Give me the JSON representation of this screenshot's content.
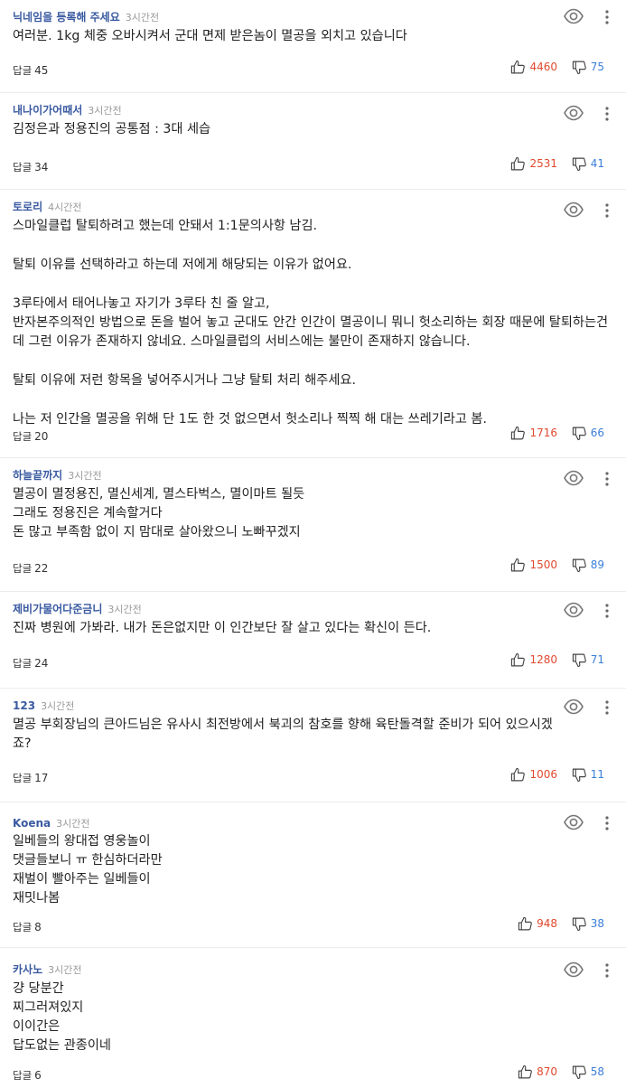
{
  "comments": [
    {
      "nickname": "닉네임을 등록해 주세요",
      "time": "3시간전",
      "body": "여러분. 1kg 체중 오바시켜서 군대 면제 받은놈이 멸공을 외치고 있습니다",
      "reply_label": "답글",
      "reply_count": "45",
      "likes": "4460",
      "dislikes": "75"
    },
    {
      "nickname": "내나이가어때서",
      "time": "3시간전",
      "body": "김정은과 정용진의 공통점 : 3대 세습",
      "reply_label": "답글",
      "reply_count": "34",
      "likes": "2531",
      "dislikes": "41"
    },
    {
      "nickname": "토로리",
      "time": "4시간전",
      "body": "스마일클럽 탈퇴하려고 했는데 안돼서 1:1문의사항 남김.\n\n탈퇴 이유를 선택하라고 하는데 저에게 해당되는 이유가 없어요.\n\n3루타에서 태어나놓고 자기가 3루타 친 줄 알고,\n반자본주의적인 방법으로 돈을 벌어 놓고 군대도 안간 인간이 멸공이니 뭐니 헛소리하는 회장 때문에 탈퇴하는건데 그런 이유가 존재하지 않네요. 스마일클럽의 서비스에는 불만이 존재하지 않습니다.\n\n탈퇴 이유에 저런 항목을 넣어주시거나 그냥 탈퇴 처리 해주세요.\n\n나는 저 인간을 멸공을 위해 단 1도 한 것 없으면서 헛소리나 찍찍 해 대는 쓰레기라고 봄.",
      "reply_label": "답글",
      "reply_count": "20",
      "likes": "1716",
      "dislikes": "66"
    },
    {
      "nickname": "하늘끝까지",
      "time": "3시간전",
      "body": "멸공이 멸정용진, 멸신세계,  멸스타벅스,  멸이마트 될듯\n그래도 정용진은 계속할거다\n돈 많고 부족함 없이 지 맘대로 살아왔으니 노빠꾸겠지",
      "reply_label": "답글",
      "reply_count": "22",
      "likes": "1500",
      "dislikes": "89"
    },
    {
      "nickname": "제비가물어다준금니",
      "time": "3시간전",
      "body": "진짜 병원에 가봐라. 내가 돈은없지만 이 인간보단 잘 살고 있다는 확신이 든다.",
      "reply_label": "답글",
      "reply_count": "24",
      "likes": "1280",
      "dislikes": "71"
    },
    {
      "nickname": "123",
      "time": "3시간전",
      "body": "멸공 부회장님의 큰아드님은 유사시 최전방에서 북괴의 참호를 향해 육탄돌격할 준비가 되어 있으시겠죠?",
      "reply_label": "답글",
      "reply_count": "17",
      "likes": "1006",
      "dislikes": "11"
    },
    {
      "nickname": "Koena",
      "time": "3시간전",
      "body": "일베들의 왕대접 영웅놀이\n댓글들보니 ㅠ 한심하더라만\n재벌이 빨아주는 일베들이\n재밋나봄",
      "reply_label": "답글",
      "reply_count": "8",
      "likes": "948",
      "dislikes": "38"
    },
    {
      "nickname": "카사노",
      "time": "3시간전",
      "body": "걍 당분간\n찌그러져있지\n이이간은\n 답도없는 관종이네",
      "reply_label": "답글",
      "reply_count": "6",
      "likes": "870",
      "dislikes": "58"
    }
  ],
  "icons": {
    "view": "eye-icon",
    "more": "more-vertical-icon",
    "like": "thumbs-up-icon",
    "dislike": "thumbs-down-icon"
  },
  "colors": {
    "nickname": "#3a5aa0",
    "time": "#9a9a9a",
    "likes": "#e0492f",
    "dislikes": "#3b7fd9",
    "divider": "#ececec"
  }
}
